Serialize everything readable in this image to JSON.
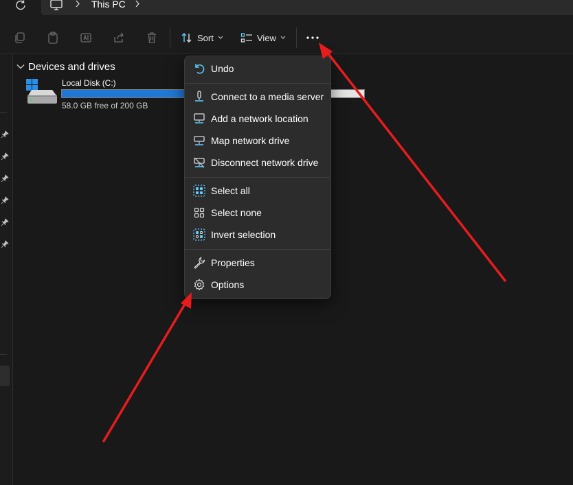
{
  "colors": {
    "accent": "#60cdff",
    "drive_fill": "#2078d6",
    "annotation": "#e81c1c",
    "menu_bg": "#2c2c2c"
  },
  "address_bar": {
    "icon": "computer-icon",
    "location": "This PC"
  },
  "command_bar": {
    "icons": [
      "copy-icon",
      "paste-icon",
      "rename-icon",
      "share-icon",
      "delete-icon"
    ],
    "sort_label": "Sort",
    "view_label": "View",
    "more_icon": "ellipsis-icon"
  },
  "content": {
    "group_title": "Devices and drives",
    "drive": {
      "name": "Local Disk (C:)",
      "free_text": "58.0 GB free of 200 GB",
      "used_fraction": 0.71
    }
  },
  "menu": {
    "undo": "Undo",
    "connect_media_server": "Connect to a media server",
    "add_network_location": "Add a network location",
    "map_network_drive": "Map network drive",
    "disconnect_network_drive": "Disconnect network drive",
    "select_all": "Select all",
    "select_none": "Select none",
    "invert_selection": "Invert selection",
    "properties": "Properties",
    "options": "Options"
  }
}
